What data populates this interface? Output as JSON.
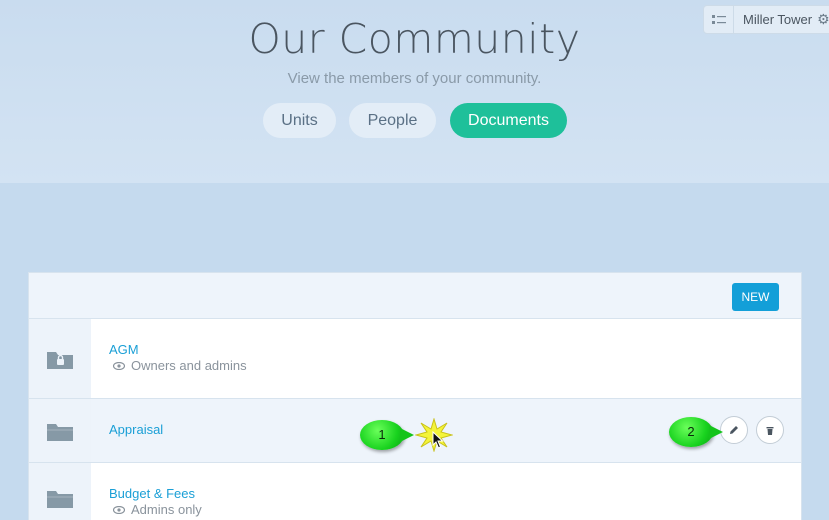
{
  "header": {
    "title": "Our Community",
    "subtitle": "View the members of your community."
  },
  "tabs": [
    {
      "label": "Units",
      "active": false
    },
    {
      "label": "People",
      "active": false
    },
    {
      "label": "Documents",
      "active": true
    }
  ],
  "context": {
    "label": "Miller Tower"
  },
  "toolbar": {
    "new_label": "NEW"
  },
  "documents": [
    {
      "name": "AGM",
      "visibility": "Owners and admins",
      "locked": true
    },
    {
      "name": "Appraisal",
      "visibility": "",
      "locked": false
    },
    {
      "name": "Budget & Fees",
      "visibility": "Admins only",
      "locked": false
    }
  ],
  "callouts": [
    "1",
    "2"
  ],
  "colors": {
    "accent": "#1ec09a",
    "link": "#1a9fd6",
    "button": "#139fd8"
  }
}
